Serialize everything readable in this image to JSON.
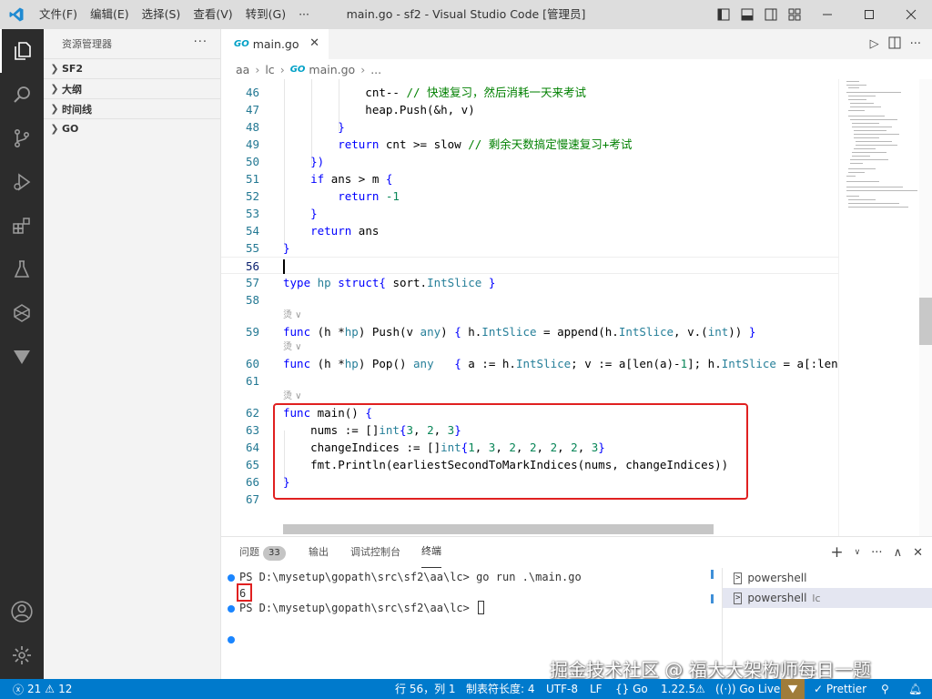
{
  "titlebar": {
    "menu": [
      "文件(F)",
      "编辑(E)",
      "选择(S)",
      "查看(V)",
      "转到(G)",
      "···"
    ],
    "title": "main.go - sf2 - Visual Studio Code [管理员]"
  },
  "sidebar": {
    "header": "资源管理器",
    "more": "···",
    "sections": [
      "SF2",
      "大纲",
      "时间线",
      "GO"
    ]
  },
  "tab": {
    "label": "main.go",
    "go_mark": "GO"
  },
  "breadcrumb": {
    "parts": [
      "aa",
      "lc",
      "main.go",
      "..."
    ]
  },
  "editor": {
    "codelens": "烫 ∨",
    "lines": {
      "l46": "46",
      "l47": "47",
      "l48": "48",
      "l49": "49",
      "l50": "50",
      "l51": "51",
      "l52": "52",
      "l53": "53",
      "l54": "54",
      "l55": "55",
      "l56": "56",
      "l57": "57",
      "l58": "58",
      "l59": "59",
      "l60": "60",
      "l61": "61",
      "l62": "62",
      "l63": "63",
      "l64": "64",
      "l65": "65",
      "l66": "66",
      "l67": "67"
    }
  },
  "panel": {
    "tabs": {
      "problems": "问题",
      "problems_count": "33",
      "output": "输出",
      "debug": "调试控制台",
      "terminal": "终端"
    },
    "terminal": {
      "line1": "PS D:\\mysetup\\gopath\\src\\sf2\\aa\\lc> go run .\\main.go",
      "line2": "6",
      "line3": "PS D:\\mysetup\\gopath\\src\\sf2\\aa\\lc> "
    },
    "terminal_list": [
      {
        "label": "powershell",
        "sub": ""
      },
      {
        "label": "powershell",
        "sub": "lc"
      }
    ]
  },
  "watermark": "掘金技术社区 @ 福大大架构师每日一题",
  "statusbar": {
    "errors": "21",
    "warnings": "12",
    "position": "行 56，列 1",
    "tab_size": "制表符长度: 4",
    "encoding": "UTF-8",
    "eol": "LF",
    "language": "Go",
    "go_version": "1.22.5",
    "go_live": "Go Live",
    "prettier": "Prettier"
  },
  "colors": {
    "accent": "#007acc",
    "activity": "#2c2c2c",
    "highlight_box": "#e02020"
  }
}
